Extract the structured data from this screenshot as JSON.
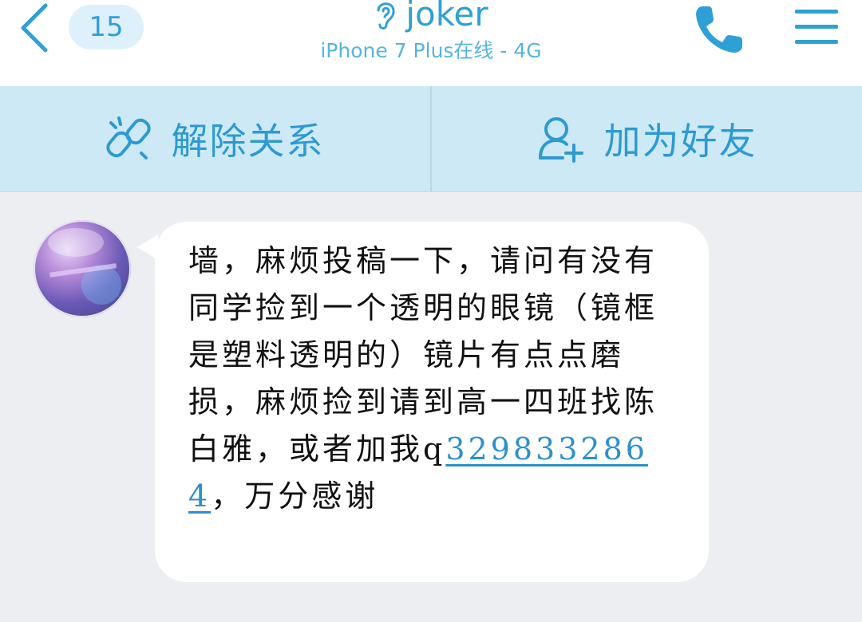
{
  "header": {
    "unread_count": "15",
    "contact_name": "joker",
    "status": "iPhone 7 Plus在线 - 4G",
    "icons": {
      "back": "chevron-left-icon",
      "status": "ear-icon",
      "call": "phone-icon",
      "menu": "hamburger-menu-icon"
    }
  },
  "actions": {
    "remove_relation": {
      "label": "解除关系",
      "icon": "unlink-icon"
    },
    "add_friend": {
      "label": "加为好友",
      "icon": "add-user-icon"
    }
  },
  "message": {
    "text_before": "墙，麻烦投稿一下，请问有没有同学捡到一个透明的眼镜（镜框是塑料透明的）镜片有点点磨损，麻烦捡到请到高一四班找陈白雅，或者加我q",
    "link": "3298332864",
    "text_after": "，万分感谢"
  },
  "colors": {
    "accent": "#2fa0d6",
    "action_bar_bg": "#cde9f6",
    "chat_bg": "#eceef2",
    "bubble_bg": "#ffffff"
  }
}
